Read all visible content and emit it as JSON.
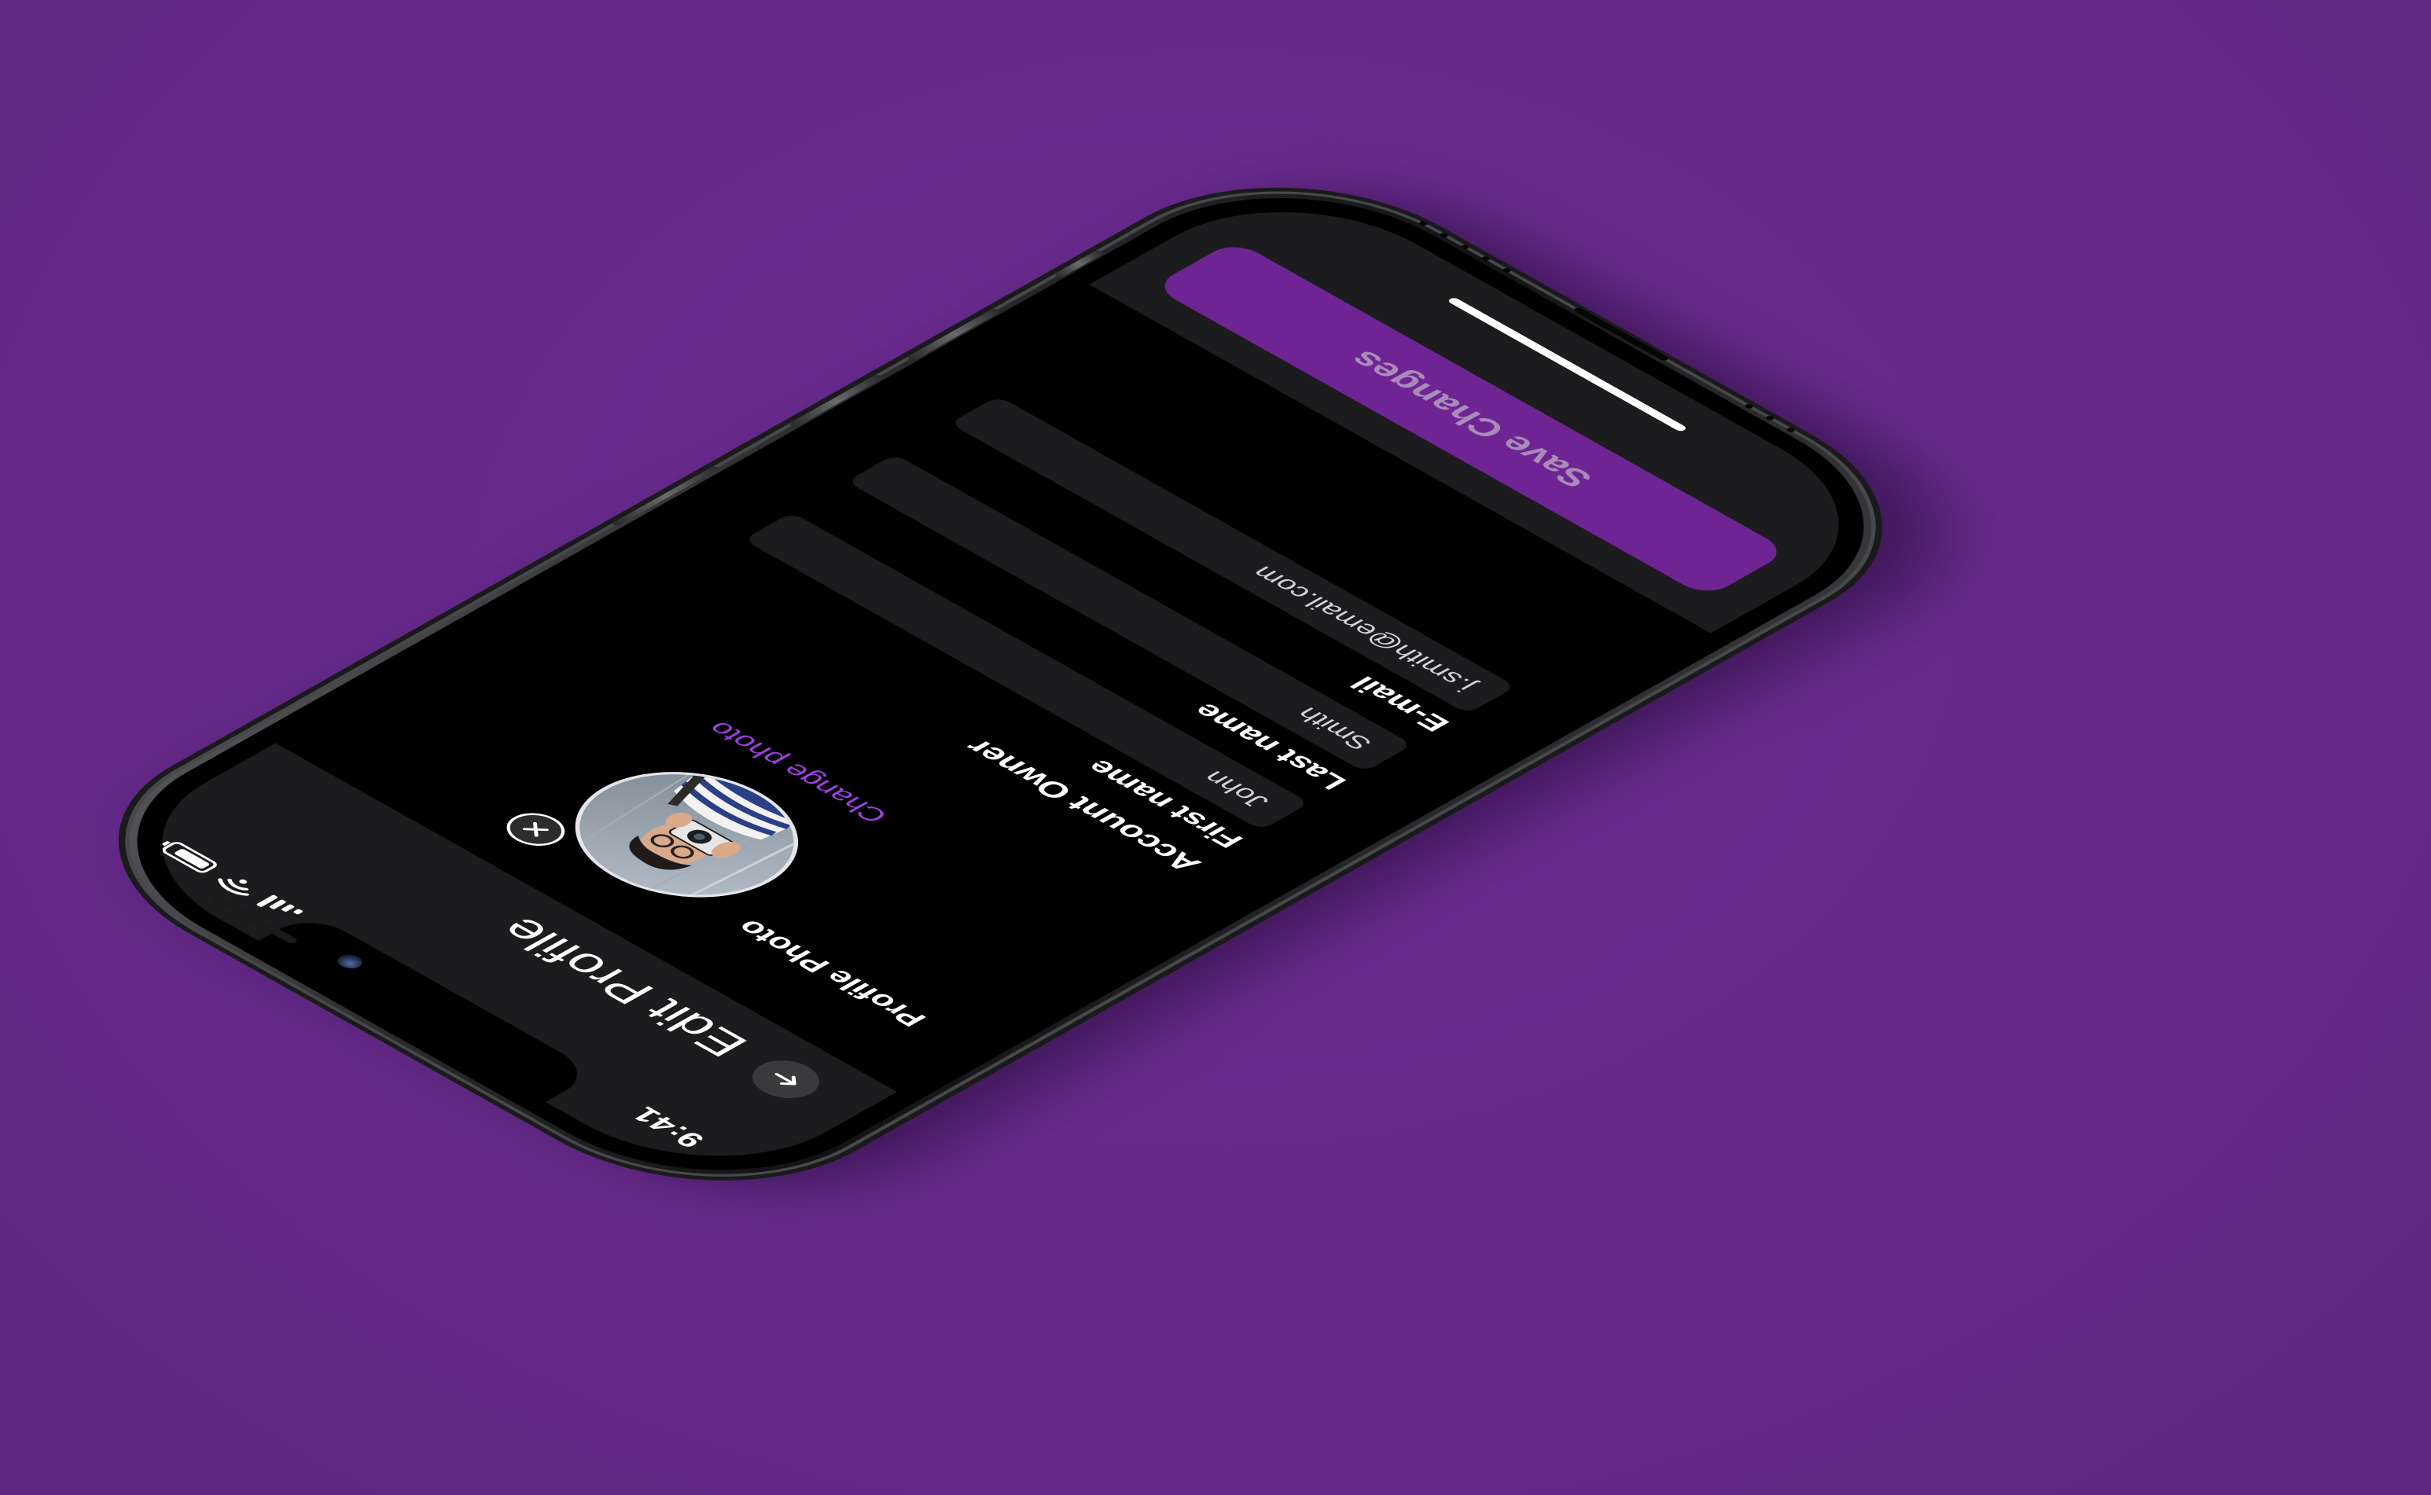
{
  "colors": {
    "background": "#662a8b",
    "accent": "#9d3fe0",
    "save_button": "#6e2593",
    "surface": "#1c1c1e",
    "field": "#1c1c1e"
  },
  "status_bar": {
    "time": "9:41",
    "battery_level": 0.85,
    "icons": [
      "signal-icon",
      "wifi-icon",
      "battery-icon"
    ]
  },
  "header": {
    "back_icon": "arrow-left-icon",
    "title": "Edit Profile"
  },
  "profile_photo": {
    "label": "Profile Photo",
    "remove_icon": "close-icon",
    "change_link": "Change photo"
  },
  "form": {
    "heading": "Account Owner",
    "fields": [
      {
        "label": "First name",
        "value": "John"
      },
      {
        "label": "Last name",
        "value": "Smith"
      },
      {
        "label": "E-mail",
        "value": "j.smith@email.com"
      }
    ]
  },
  "footer": {
    "save_label": "Save Changes"
  }
}
